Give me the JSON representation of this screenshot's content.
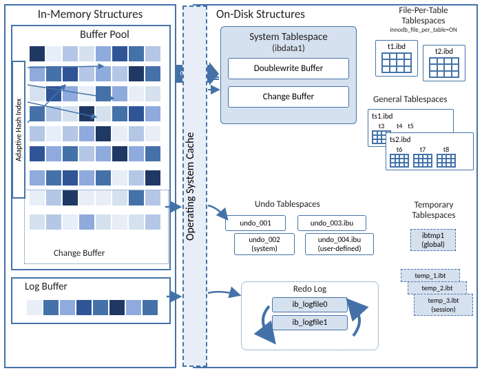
{
  "inmem": {
    "title": "In-Memory Structures",
    "buffer_pool": "Buffer Pool",
    "ahi": "Adaptive Hash Index",
    "change_buffer": "Change Buffer",
    "log_buffer": "Log Buffer"
  },
  "ondisk": {
    "title": "On-Disk Structures",
    "osc": "Operating System Cache",
    "o_direct": "O_DIRECT",
    "sys_tbs": {
      "title": "System Tablespace",
      "sub": "(ibdata1)",
      "dw": "Doublewrite Buffer",
      "cb": "Change Buffer"
    },
    "fpt": {
      "title": "File-Per-Table",
      "sub": "Tablespaces",
      "cfg": "innodb_file_per_table=ON",
      "t1": "t1.ibd",
      "t2": "t2.ibd"
    },
    "gen": {
      "title": "General Tablespaces",
      "ts1": "ts1.ibd",
      "ts2": "ts2.ibd",
      "t3": "t3",
      "t4": "t4",
      "t5": "t5",
      "t6": "t6",
      "t7": "t7",
      "t8": "t8"
    },
    "undo": {
      "title": "Undo Tablespaces",
      "u1": "undo_001",
      "u2": "undo_002",
      "u2s": "(system)",
      "u3": "undo_003.ibu",
      "u4": "undo_004.ibu",
      "u4s": "(user-defined)"
    },
    "temp": {
      "title": "Temporary",
      "sub": "Tablespaces",
      "g": "ibtmp1",
      "gs": "(global)",
      "t1": "temp_1.ibt",
      "t2": "temp_2.ibt",
      "t3": "temp_3.ibt",
      "ts": "(session)"
    },
    "redo": {
      "title": "Redo Log",
      "f0": "ib_logfile0",
      "f1": "ib_logfile1"
    }
  }
}
